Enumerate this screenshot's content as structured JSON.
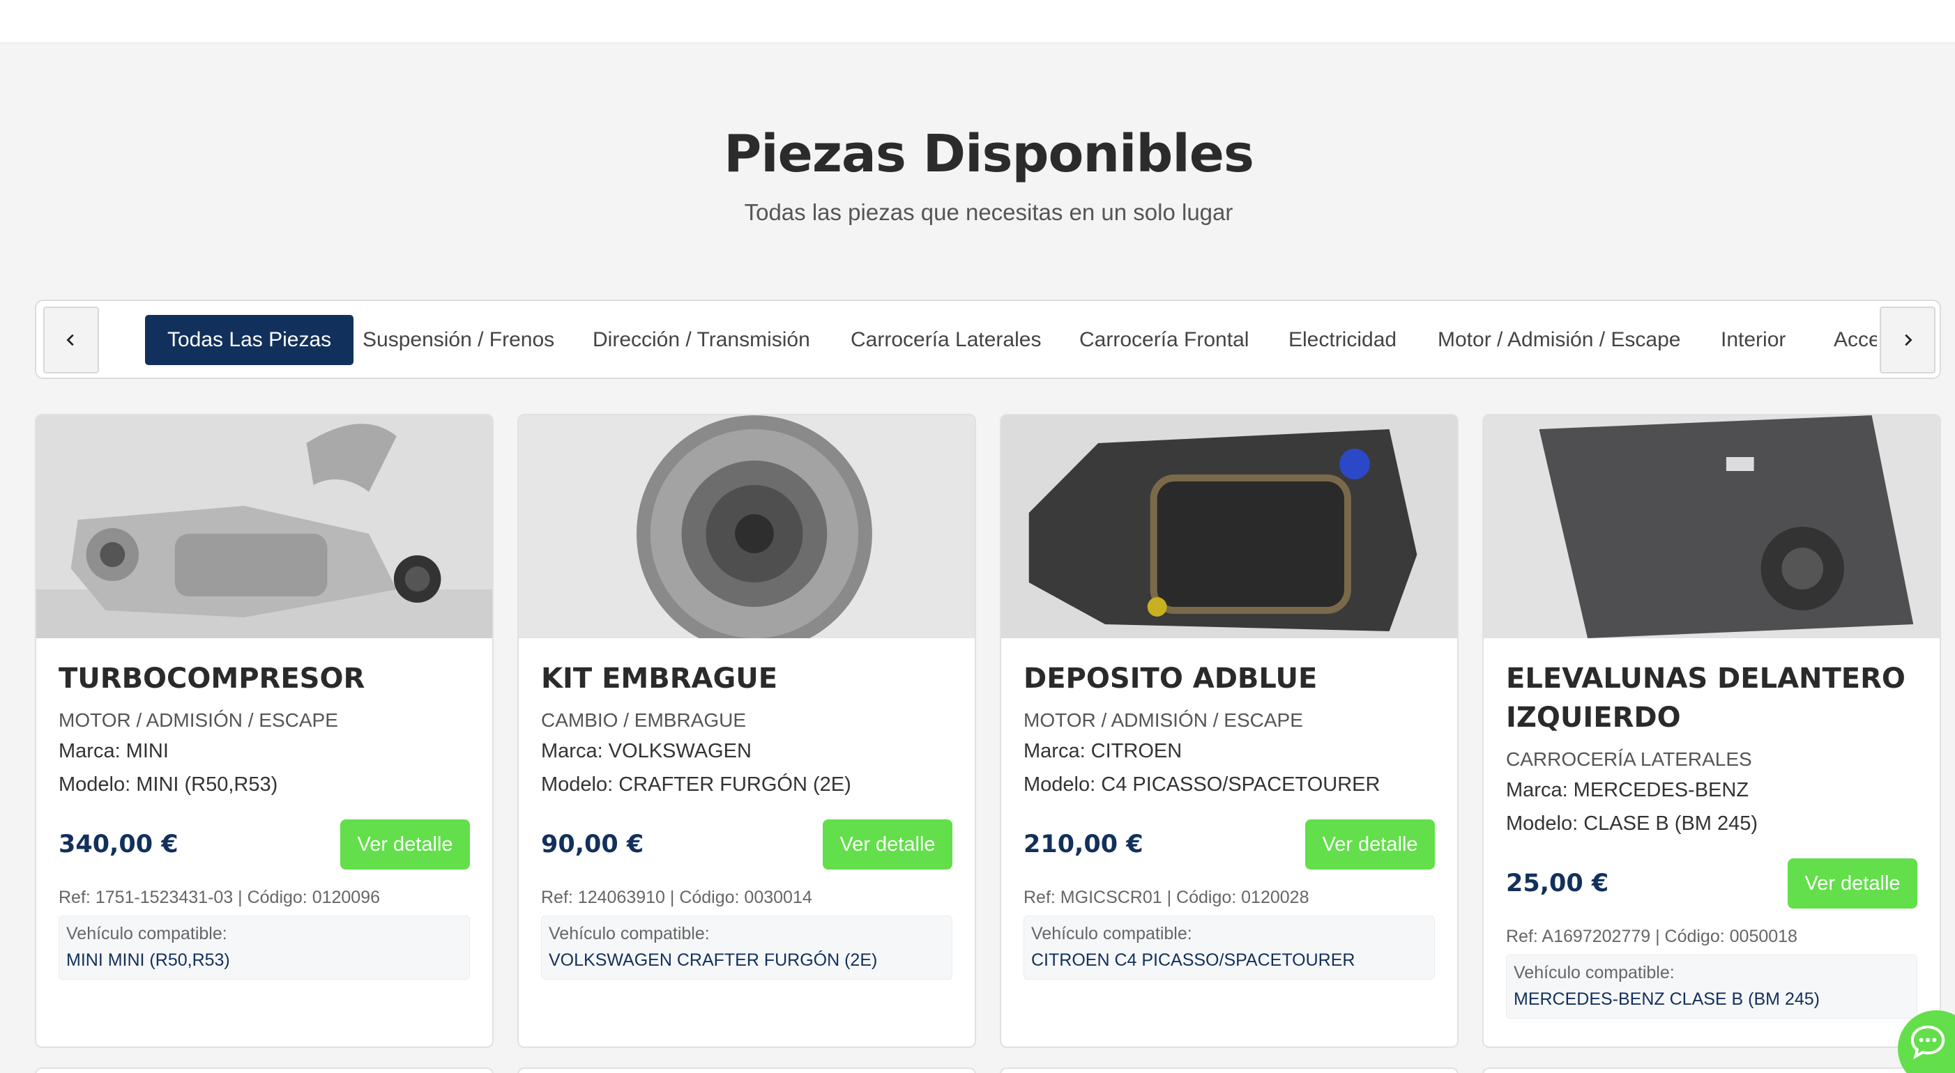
{
  "page": {
    "title": "Piezas Disponibles",
    "subtitle": "Todas las piezas que necesitas en un solo lugar"
  },
  "colors": {
    "navy": "#12305c",
    "green": "#62df4a",
    "background": "#f4f4f4"
  },
  "categories": {
    "prev_icon": "chevron-left-icon",
    "next_icon": "chevron-right-icon",
    "active_index": 0,
    "items": [
      {
        "label": "Todas Las Piezas"
      },
      {
        "label": "Suspensión / Frenos"
      },
      {
        "label": "Dirección / Transmisión"
      },
      {
        "label": "Carrocería Laterales"
      },
      {
        "label": "Carrocería Frontal"
      },
      {
        "label": "Electricidad"
      },
      {
        "label": "Motor / Admisión / Escape"
      },
      {
        "label": "Interior"
      },
      {
        "label": "Accesorios"
      }
    ]
  },
  "labels": {
    "marca": "Marca:",
    "modelo": "Modelo:",
    "ref": "Ref:",
    "codigo": "Código:",
    "compatible": "Vehículo compatible:",
    "button": "Ver detalle"
  },
  "products": [
    {
      "title": "TURBOCOMPRESOR",
      "category": "MOTOR / ADMISIÓN / ESCAPE",
      "marca": "Marca: MINI",
      "modelo": "Modelo: MINI (R50,R53)",
      "price": "340,00 €",
      "button": "Ver detalle",
      "ref": "Ref: 1751-1523431-03 | Código: 0120096",
      "compat_label": "Vehículo compatible:",
      "compat_value": "MINI MINI (R50,R53)"
    },
    {
      "title": "KIT EMBRAGUE",
      "category": "CAMBIO / EMBRAGUE",
      "marca": "Marca: VOLKSWAGEN",
      "modelo": "Modelo: CRAFTER FURGÓN (2E)",
      "price": "90,00 €",
      "button": "Ver detalle",
      "ref": "Ref: 124063910 | Código: 0030014",
      "compat_label": "Vehículo compatible:",
      "compat_value": "VOLKSWAGEN CRAFTER FURGÓN (2E)"
    },
    {
      "title": "DEPOSITO ADBLUE",
      "category": "MOTOR / ADMISIÓN / ESCAPE",
      "marca": "Marca: CITROEN",
      "modelo": "Modelo: C4 PICASSO/SPACETOURER",
      "price": "210,00 €",
      "button": "Ver detalle",
      "ref": "Ref: MGICSCR01 | Código: 0120028",
      "compat_label": "Vehículo compatible:",
      "compat_value": "CITROEN C4 PICASSO/SPACETOURER"
    },
    {
      "title": "ELEVALUNAS DELANTERO IZQUIERDO",
      "category": "CARROCERÍA LATERALES",
      "marca": "Marca: MERCEDES-BENZ",
      "modelo": "Modelo: CLASE B (BM 245)",
      "price": "25,00 €",
      "button": "Ver detalle",
      "ref": "Ref: A1697202779 | Código: 0050018",
      "compat_label": "Vehículo compatible:",
      "compat_value": "MERCEDES-BENZ CLASE B (BM 245)"
    }
  ],
  "chat": {
    "icon": "chat-bubble-icon"
  }
}
